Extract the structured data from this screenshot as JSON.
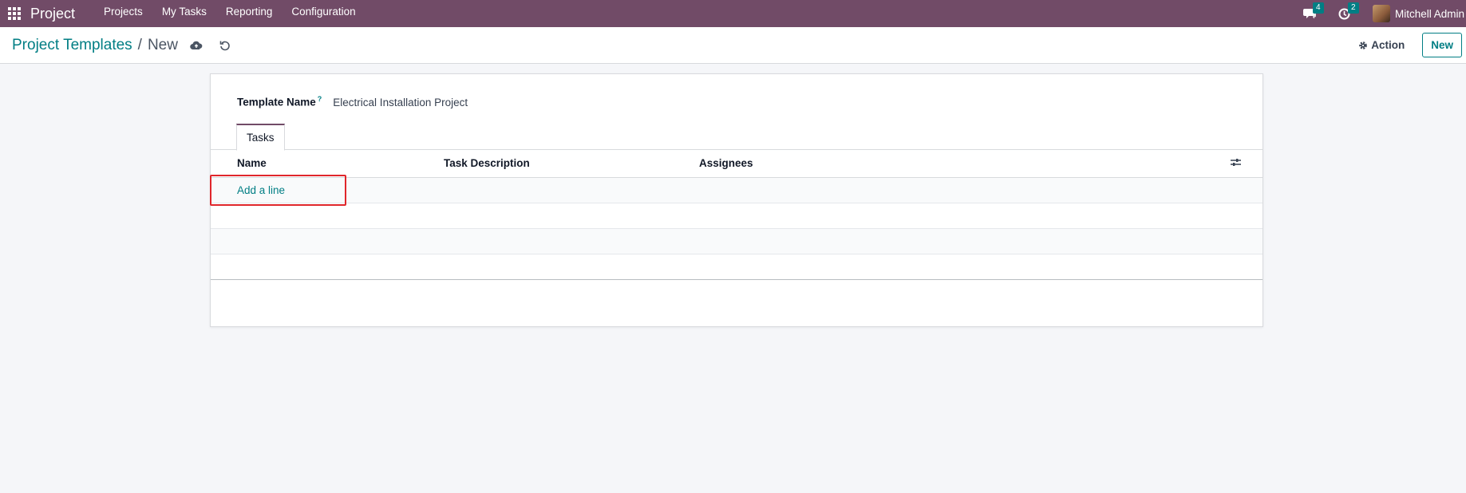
{
  "navbar": {
    "app_name": "Project",
    "menu": [
      "Projects",
      "My Tasks",
      "Reporting",
      "Configuration"
    ],
    "messages_count": "4",
    "activities_count": "2",
    "user_name": "Mitchell Admin"
  },
  "control_panel": {
    "breadcrumb_parent": "Project Templates",
    "breadcrumb_separator": "/",
    "breadcrumb_current": "New",
    "action_label": "Action",
    "new_label": "New"
  },
  "form": {
    "template_name_label": "Template Name",
    "help_mark": "?",
    "template_name_value": "Electrical Installation Project",
    "tab_label": "Tasks",
    "columns": [
      "Name",
      "Task Description",
      "Assignees"
    ],
    "add_line_label": "Add a line"
  },
  "colors": {
    "navbar": "#714b67",
    "accent": "#017e84",
    "highlight": "#e0262b"
  },
  "icons": {
    "apps": "apps-grid-icon",
    "messages": "chat-icon",
    "activities": "clock-icon",
    "save": "cloud-upload-icon",
    "discard": "undo-icon",
    "action": "gear-icon",
    "optional_columns": "sliders-icon"
  }
}
